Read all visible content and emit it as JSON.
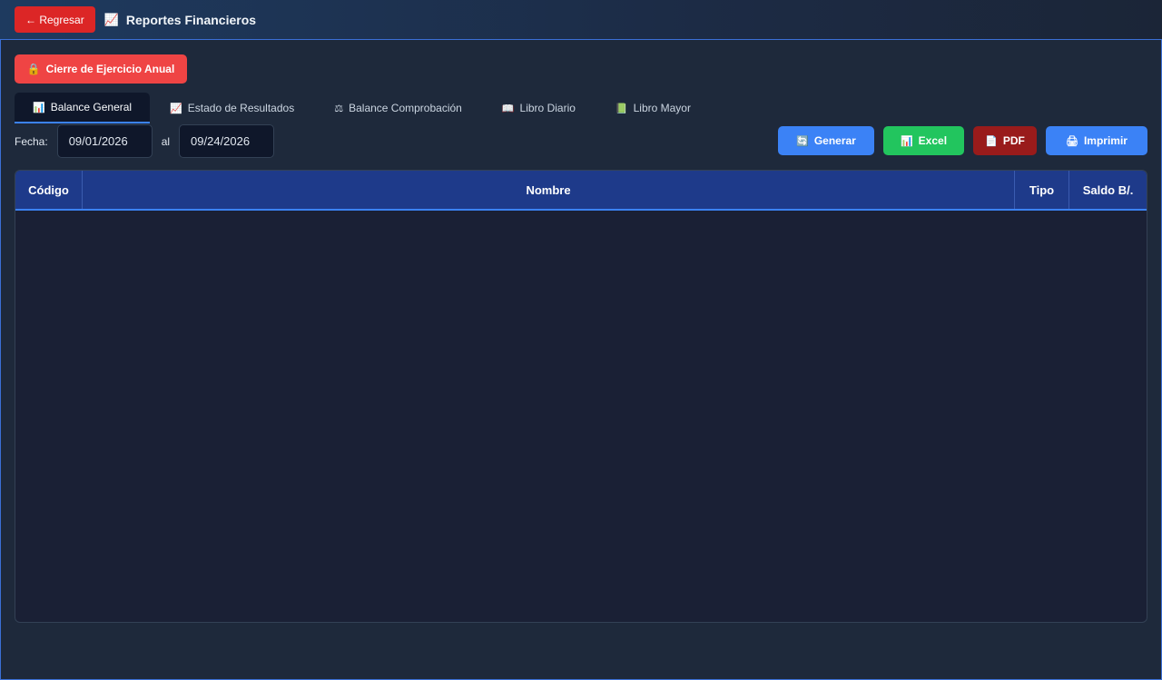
{
  "header": {
    "back_label": "← Regresar",
    "title_icon": "chart-increasing-icon",
    "title": "Reportes Financieros"
  },
  "close_year": {
    "icon": "lock-icon",
    "label": "Cierre de Ejercicio Anual"
  },
  "tabs": [
    {
      "icon": "bar-chart-icon",
      "label": "Balance General",
      "active": true
    },
    {
      "icon": "chart-increasing-icon",
      "label": "Estado de Resultados",
      "active": false
    },
    {
      "icon": "balance-scale-icon",
      "label": "Balance Comprobación",
      "active": false
    },
    {
      "icon": "open-book-icon",
      "label": "Libro Diario",
      "active": false
    },
    {
      "icon": "green-book-icon",
      "label": "Libro Mayor",
      "active": false
    }
  ],
  "filter": {
    "label": "Fecha:",
    "from": "09/01/2026",
    "to_label": "al",
    "to": "09/24/2026"
  },
  "actions": {
    "generate": "Generar",
    "excel": "Excel",
    "pdf": "PDF",
    "print": "Imprimir"
  },
  "table": {
    "columns": [
      "Código",
      "Nombre",
      "Tipo",
      "Saldo B/."
    ],
    "rows": []
  },
  "colors": {
    "accent": "#3b82f6",
    "danger": "#dc2626",
    "success": "#22c55e",
    "pdf": "#991b1b",
    "header_bg": "#1e3a8a"
  }
}
